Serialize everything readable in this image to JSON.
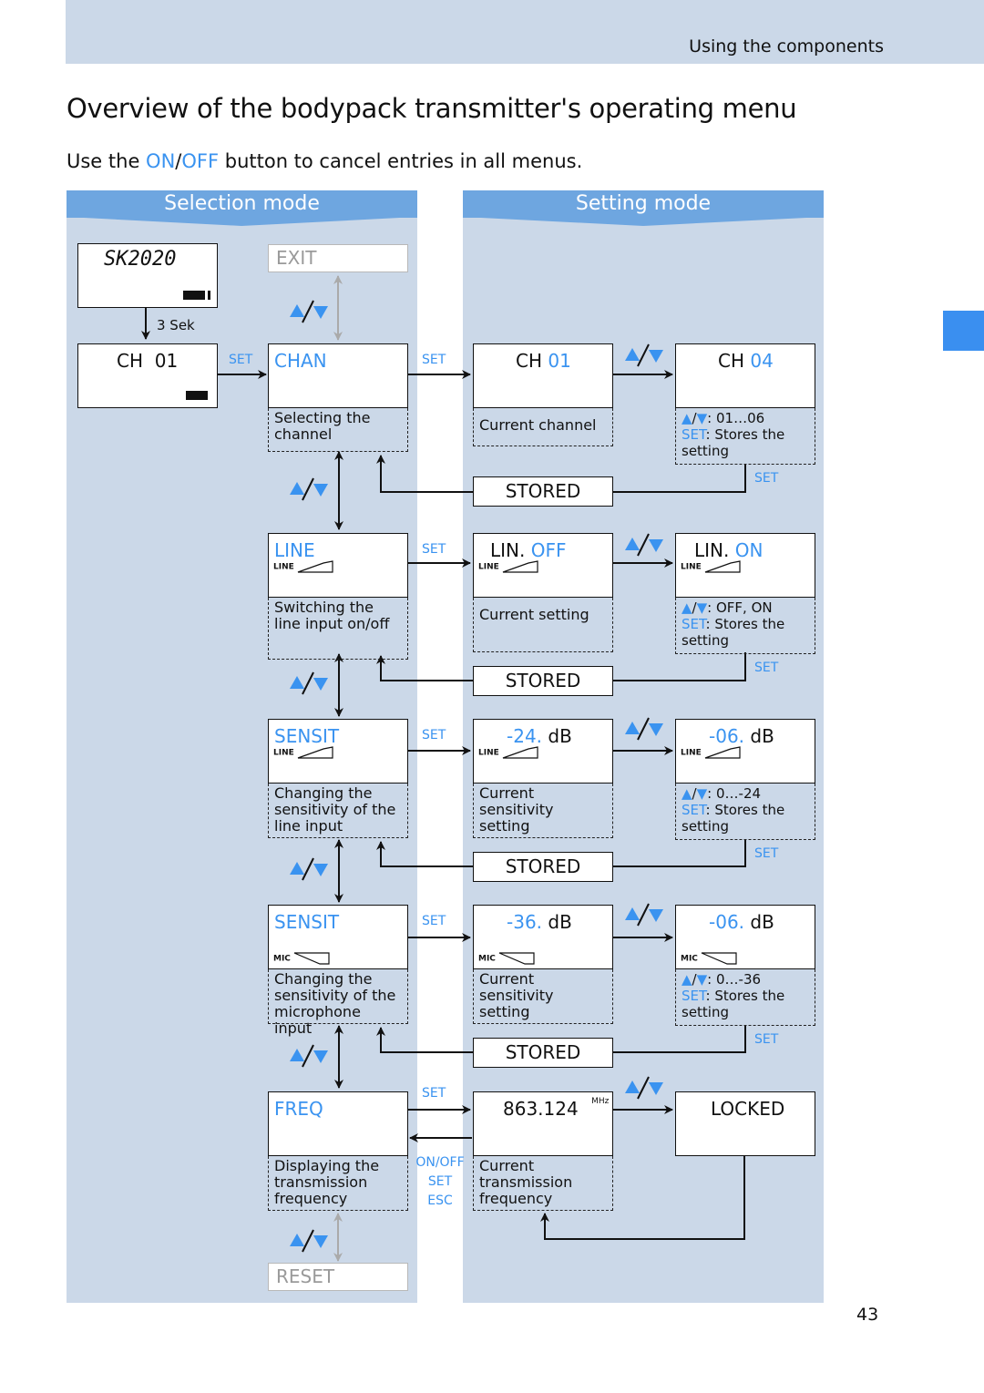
{
  "header": {
    "section": "Using the components"
  },
  "title": "Overview of the bodypack transmitter's operating menu",
  "intro": {
    "before": "Use the ",
    "on": "ON",
    "slash": "/",
    "off": "OFF",
    "after": " button to cancel entries in all menus."
  },
  "panels": {
    "selection": "Selection mode",
    "setting": "Setting mode"
  },
  "colors": {
    "accent": "#3a93f0",
    "panel": "#cbd8e8",
    "banner": "#6ea6e0",
    "tab": "#3a8ff0"
  },
  "labels": {
    "set": "SET",
    "three_sec": "3 Sek",
    "on_off": "ON/OFF",
    "esc": "ESC",
    "stored": "STORED",
    "updown_slash": "/",
    "stores_the": ": Stores the",
    "setting_word": "setting"
  },
  "start": {
    "display": "SK2020",
    "ch": "CH  01"
  },
  "exit": "EXIT",
  "reset": "RESET",
  "rows": [
    {
      "menu": "CHAN",
      "desc": [
        "Selecting the",
        "channel"
      ],
      "current": {
        "prefix": "CH ",
        "value": "01",
        "suffix": ""
      },
      "current_desc": [
        "Current channel"
      ],
      "new": {
        "prefix": "CH ",
        "value": "04",
        "suffix": ""
      },
      "range": "01…06"
    },
    {
      "menu": "LINE",
      "meter": "LINE",
      "desc": [
        "Switching the",
        "line input on/off"
      ],
      "current": {
        "prefix": "LIN. ",
        "value": "OFF",
        "suffix": ""
      },
      "current_desc": [
        "Current setting"
      ],
      "new": {
        "prefix": "LIN. ",
        "value": "ON",
        "suffix": ""
      },
      "range": "OFF, ON"
    },
    {
      "menu": "SENSIT",
      "meter": "LINE",
      "desc": [
        "Changing the",
        "sensitivity of the",
        "line input"
      ],
      "current": {
        "prefix": "",
        "value": "-24.",
        "suffix": " dB"
      },
      "current_desc": [
        "Current",
        "sensitivity",
        "setting"
      ],
      "new": {
        "prefix": "",
        "value": "-06.",
        "suffix": " dB"
      },
      "range": "0…-24"
    },
    {
      "menu": "SENSIT",
      "meter": "MIC",
      "desc": [
        "Changing the",
        "sensitivity of the",
        "microphone input"
      ],
      "current": {
        "prefix": "",
        "value": "-36.",
        "suffix": " dB"
      },
      "current_desc": [
        "Current",
        "sensitivity",
        "setting"
      ],
      "new": {
        "prefix": "",
        "value": "-06.",
        "suffix": " dB"
      },
      "range": "0…-36"
    },
    {
      "menu": "FREQ",
      "desc": [
        "Displaying the",
        "transmission",
        "frequency"
      ],
      "current": {
        "value": "863.124",
        "unit": "MHz"
      },
      "current_desc": [
        "Current",
        "transmission",
        "frequency"
      ],
      "new": {
        "value": "LOCKED"
      }
    }
  ],
  "page_number": "43"
}
